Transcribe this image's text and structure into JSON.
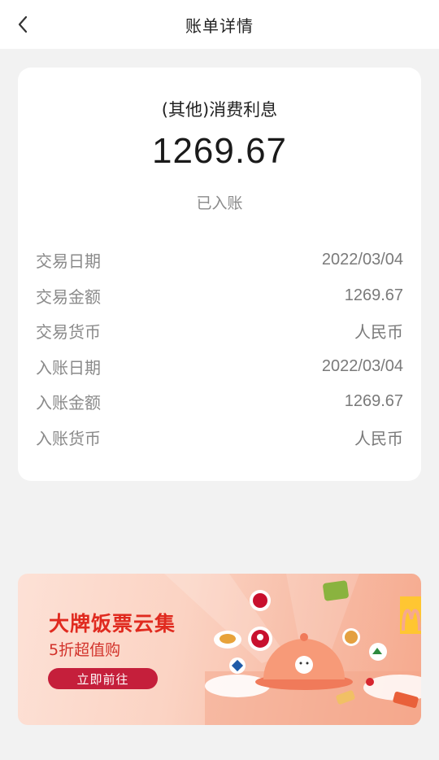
{
  "header": {
    "title": "账单详情"
  },
  "detail": {
    "type_label": "(其他)消费利息",
    "amount": "1269.67",
    "status": "已入账",
    "rows": [
      {
        "label": "交易日期",
        "value": "2022/03/04"
      },
      {
        "label": "交易金额",
        "value": "1269.67"
      },
      {
        "label": "交易货币",
        "value": "人民币"
      },
      {
        "label": "入账日期",
        "value": "2022/03/04"
      },
      {
        "label": "入账金额",
        "value": "1269.67"
      },
      {
        "label": "入账货币",
        "value": "人民币"
      }
    ]
  },
  "banner": {
    "title": "大牌饭票云集",
    "subtitle": "5折超值购",
    "button_label": "立即前往",
    "brand_icons": [
      "pizza-hut-logo",
      "kfc-logo",
      "mcdonalds-logo",
      "domino-logo",
      "food-dome-illustration"
    ]
  },
  "colors": {
    "accent": "#e02a1f",
    "button": "#c51f3b",
    "background": "#f2f2f2"
  }
}
